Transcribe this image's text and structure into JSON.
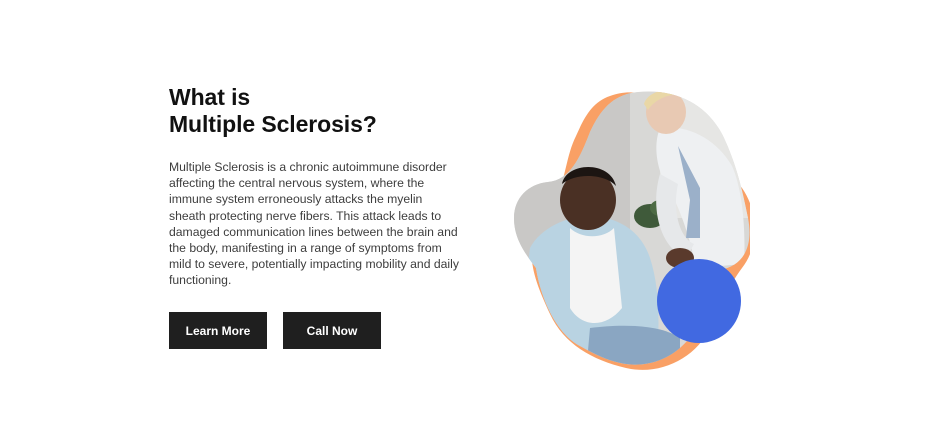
{
  "heading": {
    "line1": "What is",
    "line2": "Multiple Sclerosis?"
  },
  "description": "Multiple Sclerosis is a chronic autoimmune disorder affecting the central nervous system, where the immune system erroneously attacks the myelin sheath protecting nerve fibers. This attack leads to damaged communication lines between the brain and the body, manifesting in a range of symptoms from mild to severe, potentially impacting mobility and daily functioning.",
  "buttons": {
    "learn_more": "Learn More",
    "call_now": "Call Now"
  },
  "colors": {
    "accent_orange": "#f9a065",
    "accent_blue": "#4169e1",
    "button_bg": "#1f1f1f"
  },
  "illustration": {
    "icon": "doctor-patient-photo"
  }
}
